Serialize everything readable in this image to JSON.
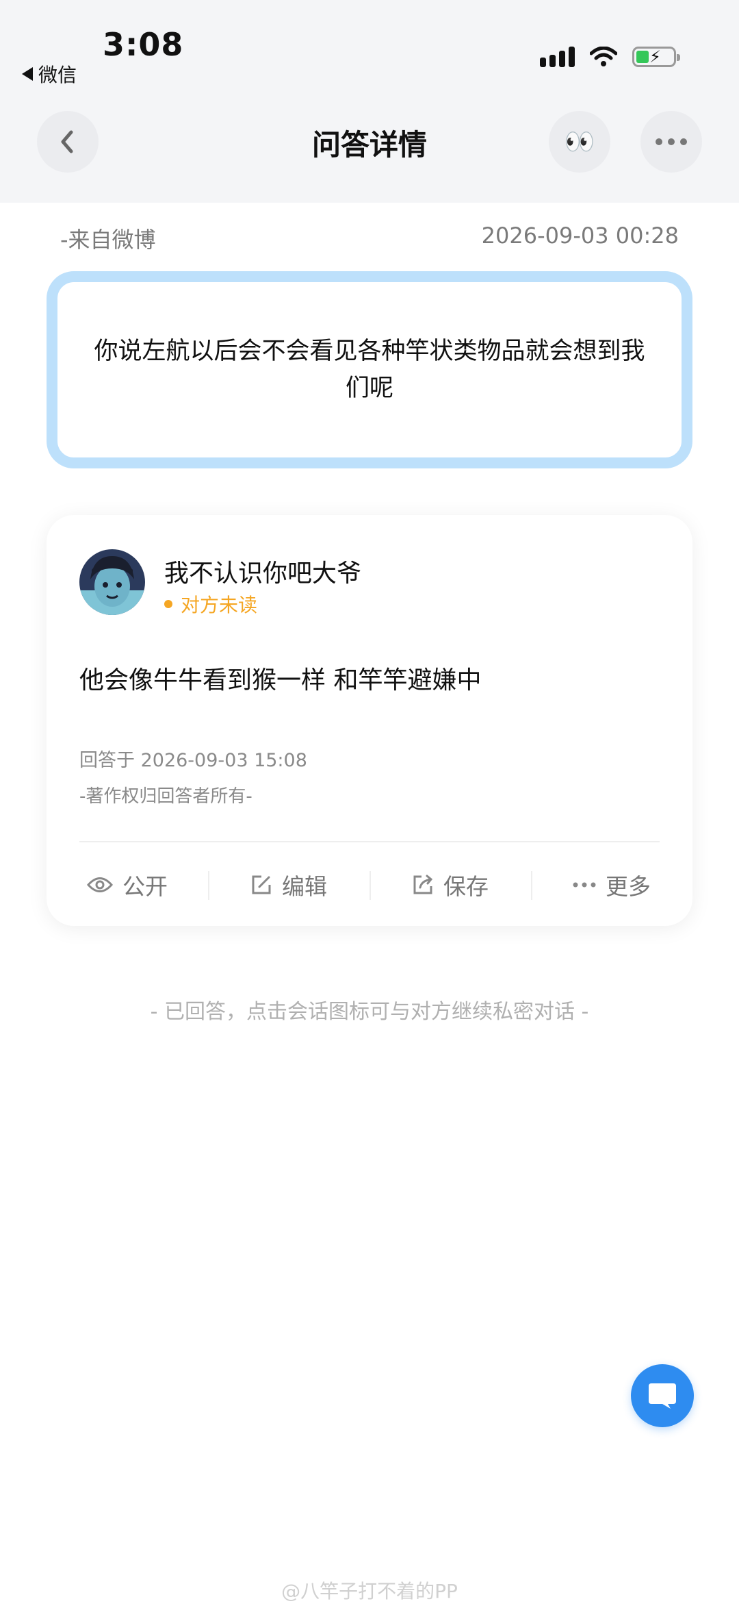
{
  "status_bar": {
    "time": "3:08",
    "back_app": "微信"
  },
  "nav": {
    "title": "问答详情",
    "eyes_emoji": "👀"
  },
  "meta": {
    "source": "-来自微博",
    "date": "2026-09-03 00:28"
  },
  "question": {
    "text": "你说左航以后会不会看见各种竿状类物品就会想到我们呢"
  },
  "answer": {
    "username": "我不认识你吧大爷",
    "status": "对方未读",
    "text": "他会像牛牛看到猴一样 和竿竿避嫌中",
    "time": "回答于 2026-09-03 15:08",
    "copyright": "-著作权归回答者所有-",
    "actions": {
      "public": "公开",
      "edit": "编辑",
      "save": "保存",
      "more": "更多"
    }
  },
  "hint": "- 已回答，点击会话图标可与对方继续私密对话 -",
  "watermark": "@八竿子打不着的PP",
  "colors": {
    "accent": "#2e8cf0",
    "question_border": "#bde0fb",
    "unread": "#f5a623"
  }
}
